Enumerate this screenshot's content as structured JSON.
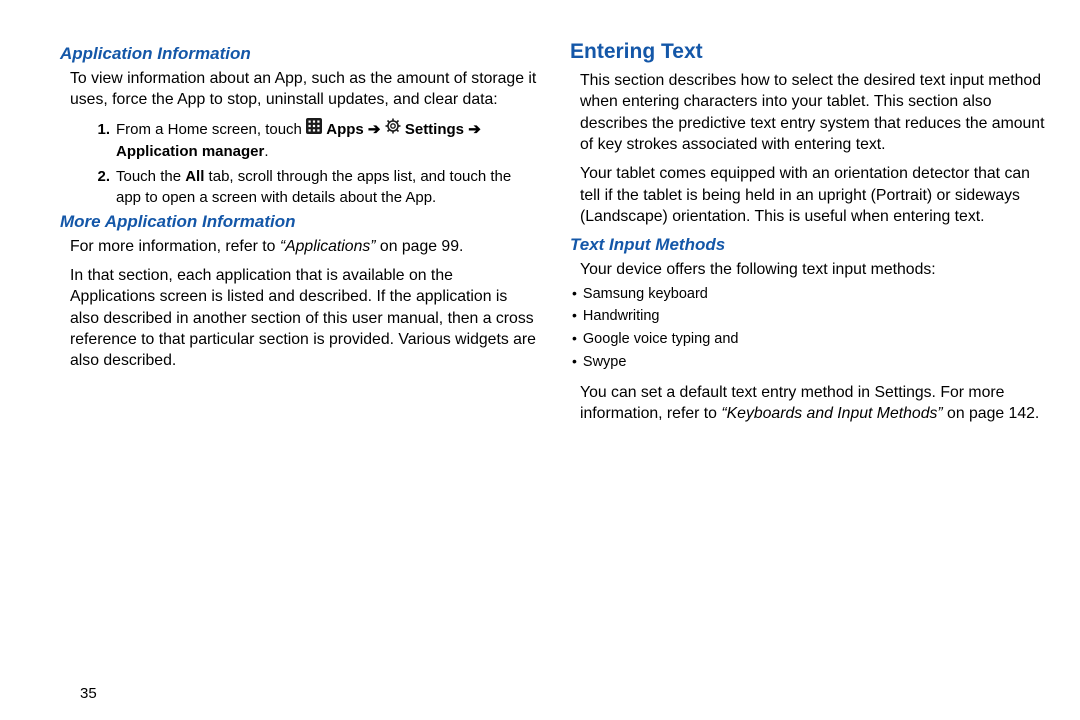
{
  "pageNumber": "35",
  "left": {
    "h1": "Application Information",
    "intro": "To view information about an App, such as the amount of storage it uses, force the App to stop, uninstall updates, and clear data:",
    "step1_num": "1.",
    "step1_prefix": "From a Home screen, touch ",
    "step1_apps": "Apps",
    "step1_settings": "Settings",
    "step1_appmgr": "Application manager",
    "arrow": "➔",
    "step2_num": "2.",
    "step2_a": "Touch the ",
    "step2_all": "All",
    "step2_b": " tab, scroll through the apps list, and touch the app to open a screen with details about the App.",
    "h2": "More Application Information",
    "more_a": "For more information, refer to ",
    "more_ref": "“Applications”",
    "more_b": " on page 99.",
    "more_para2": "In that section, each application that is available on the Applications screen is listed and described. If the application is also described in another section of this user manual, then a cross reference to that particular section is provided. Various widgets are also described."
  },
  "right": {
    "h0": "Entering Text",
    "p1": "This section describes how to select the desired text input method when entering characters into your tablet. This section also describes the predictive text entry system that reduces the amount of key strokes associated with entering text.",
    "p2": "Your tablet comes equipped with an orientation detector that can tell if the tablet is being held in an upright (Portrait) or sideways (Landscape) orientation. This is useful when entering text.",
    "h3": "Text Input Methods",
    "methods_intro": "Your device offers the following text input methods:",
    "b1": "Samsung keyboard",
    "b2": "Handwriting",
    "b3": "Google voice typing and",
    "b4": "Swype",
    "outro_a": "You can set a default text entry method in Settings. For more information, refer to ",
    "outro_ref": "“Keyboards and Input Methods”",
    "outro_b": " on page 142."
  }
}
